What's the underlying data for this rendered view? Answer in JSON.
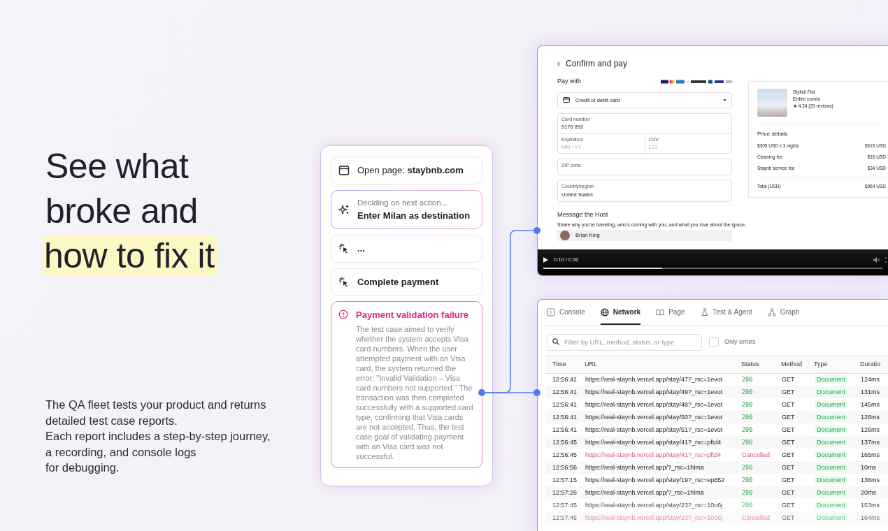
{
  "hero": {
    "headline": [
      {
        "text": "See what",
        "highlighted": false
      },
      {
        "text": "broke and",
        "highlighted": false
      },
      {
        "text": "how to fix it",
        "highlighted": true
      }
    ],
    "description": [
      "The QA fleet tests your product and returns",
      "detailed test case reports.",
      "Each report includes a step-by-step journey,",
      "a recording, and console logs",
      "for debugging."
    ]
  },
  "steps": [
    {
      "kind": "browser",
      "active": false,
      "label": "Open page: **staybnb.com**"
    },
    {
      "kind": "ai",
      "active": true,
      "status": "Deciding on next action...",
      "label": "Enter Milan as destination"
    },
    {
      "kind": "click",
      "active": false,
      "label": "..."
    },
    {
      "kind": "click",
      "active": false,
      "label": "Complete payment"
    },
    {
      "kind": "error",
      "active": false,
      "label": "Payment validation failure",
      "body": "The test case aimed to verify whether the system accepts Visa card numbers. When the user attempted payment with an Visa card, the system returned the error: \"Invalid Validation – Visa card numbers not supported.\" The transaction was then completed successfully with a supported card type, confirming that Visa cards are not accepted. Thus, the test case goal of validating payment with an Visa card was not successful."
    }
  ],
  "recording": {
    "back": "‹",
    "title": "Confirm and pay",
    "pay_with": "Pay with",
    "payment_method": "Credit or debit card",
    "card_number": {
      "label": "Card number",
      "value": "5176 892"
    },
    "expiration": {
      "label": "Expiration",
      "placeholder": "MM / YY"
    },
    "cvv": {
      "label": "CVV",
      "placeholder": "123"
    },
    "zip": {
      "label": "ZIP code"
    },
    "country": {
      "label": "Country/region",
      "value": "United States"
    },
    "listing": {
      "name": "Stylish Flat",
      "type": "Entire condo",
      "rating": "★ 4.24 (29 reviews)"
    },
    "price_title": "Price details",
    "prices": [
      {
        "label": "$305 USD x 3 nights",
        "amount": "$915 USD"
      },
      {
        "label": "Cleaning fee",
        "amount": "$15 USD"
      },
      {
        "label": "Staynb service fee",
        "amount": "$34 USD"
      }
    ],
    "total": {
      "label": "Total (USD)",
      "amount": "$964 USD"
    },
    "message_title": "Message the Host",
    "message_hint": "Share why you're traveling, who's coming with you, and what you love about the space.",
    "host": "Brian King",
    "video": {
      "time": "0:10 / 0:30",
      "level": 0.35
    }
  },
  "network": {
    "tabs": [
      {
        "kind": "console",
        "label": "Console",
        "selected": false
      },
      {
        "kind": "network",
        "label": "Network",
        "selected": true
      },
      {
        "kind": "page",
        "label": "Page",
        "selected": false
      },
      {
        "kind": "test",
        "label": "Test & Agent",
        "selected": false
      },
      {
        "kind": "graph",
        "label": "Graph",
        "selected": false
      }
    ],
    "search": {
      "placeholder": "Filter by URL, method, status, or type"
    },
    "only_errors": {
      "label": "Only errors",
      "checked": false
    },
    "columns": [
      "Time",
      "URL",
      "Status",
      "Method",
      "Type",
      "Duratio"
    ],
    "rows": [
      {
        "time": "12:56:41",
        "url": "https://real-staynb.vercel.app/stay/47?_rsc=1evot",
        "status": "200",
        "failed": false,
        "method": "GET",
        "type": "Document",
        "duration": "124ms"
      },
      {
        "time": "12:56:41",
        "url": "https://real-staynb.vercel.app/stay/49?_rsc=1evot",
        "status": "200",
        "failed": false,
        "method": "GET",
        "type": "Document",
        "duration": "131ms"
      },
      {
        "time": "12:56:41",
        "url": "https://real-staynb.vercel.app/stay/48?_rsc=1evot",
        "status": "200",
        "failed": false,
        "method": "GET",
        "type": "Document",
        "duration": "145ms"
      },
      {
        "time": "12:56:41",
        "url": "https://real-staynb.vercel.app/stay/50?_rsc=1evot",
        "status": "200",
        "failed": false,
        "method": "GET",
        "type": "Document",
        "duration": "126ms"
      },
      {
        "time": "12:56:41",
        "url": "https://real-staynb.vercel.app/stay/51?_rsc=1evot",
        "status": "200",
        "failed": false,
        "method": "GET",
        "type": "Document",
        "duration": "126ms"
      },
      {
        "time": "12:56:45",
        "url": "https://real-staynb.vercel.app/stay/41?_rsc=pftd4",
        "status": "200",
        "failed": false,
        "method": "GET",
        "type": "Document",
        "duration": "137ms"
      },
      {
        "time": "12:56:45",
        "url": "https://real-staynb.vercel.app/stay/41?_rsc=pftd4",
        "status": "Cancelled",
        "failed": true,
        "method": "GET",
        "type": "Document",
        "duration": "165ms"
      },
      {
        "time": "12:56:56",
        "url": "https://real-staynb.vercel.app/?_rsc=1hlma",
        "status": "200",
        "failed": false,
        "method": "GET",
        "type": "Document",
        "duration": "10ms"
      },
      {
        "time": "12:57:15",
        "url": "https://real-staynb.vercel.app/stay/19?_rsc=ep852",
        "status": "200",
        "failed": false,
        "method": "GET",
        "type": "Document",
        "duration": "136ms"
      },
      {
        "time": "12:57:26",
        "url": "https://real-staynb.vercel.app/?_rsc=1hlma",
        "status": "200",
        "failed": false,
        "method": "GET",
        "type": "Document",
        "duration": "20ms"
      },
      {
        "time": "12:57:45",
        "url": "https://real-staynb.vercel.app/stay/23?_rsc=10o6j",
        "status": "200",
        "failed": false,
        "method": "GET",
        "type": "Document",
        "duration": "153ms"
      },
      {
        "time": "12:57:45",
        "url": "https://real-staynb.vercel.app/stay/23?_rsc=10o6j",
        "status": "Cancelled",
        "failed": true,
        "method": "GET",
        "type": "Document",
        "duration": "164ms"
      }
    ]
  }
}
